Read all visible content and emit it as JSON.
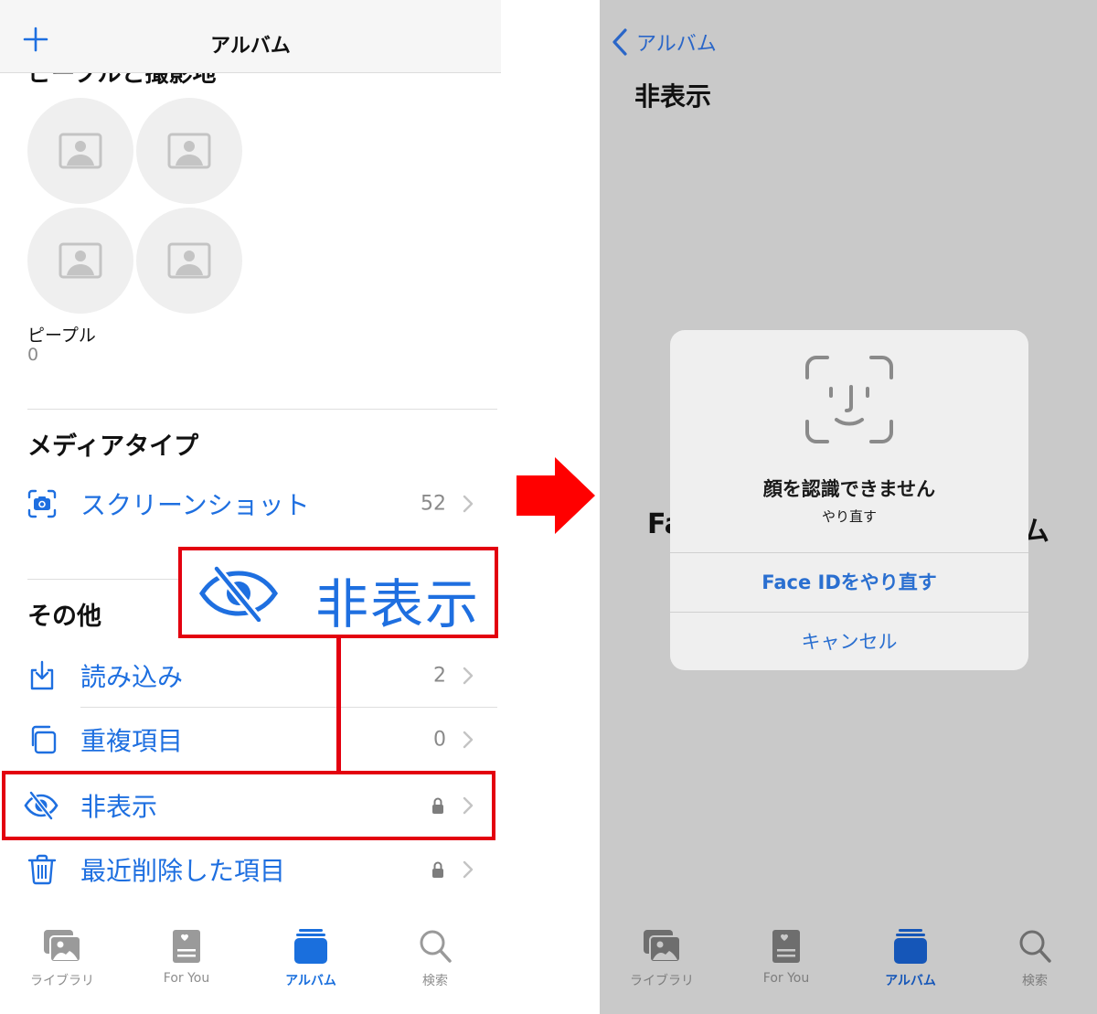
{
  "left": {
    "navbar": {
      "title": "アルバム",
      "add_icon": "plus-icon"
    },
    "cut_heading": "ピープルと撮影地",
    "people": {
      "label": "ピープル",
      "count": "0",
      "placeholder_icon": "person-placeholder-icon"
    },
    "media_types": {
      "title": "メディアタイプ",
      "items": [
        {
          "label": "スクリーンショット",
          "count": "52",
          "icon": "screenshot-icon"
        }
      ]
    },
    "other": {
      "title": "その他",
      "items": [
        {
          "label": "読み込み",
          "count": "2",
          "icon": "import-icon",
          "locked": false
        },
        {
          "label": "重複項目",
          "count": "0",
          "icon": "duplicate-icon",
          "locked": false
        },
        {
          "label": "非表示",
          "count": "",
          "icon": "eye-slash-icon",
          "locked": true
        },
        {
          "label": "最近削除した項目",
          "count": "",
          "icon": "trash-icon",
          "locked": true
        }
      ]
    },
    "callout": {
      "label": "非表示",
      "icon": "eye-slash-icon",
      "color": "#e3000f"
    },
    "tabbar": [
      {
        "label": "ライブラリ",
        "icon": "photo-library-icon",
        "active": false
      },
      {
        "label": "For You",
        "icon": "for-you-icon",
        "active": false
      },
      {
        "label": "アルバム",
        "icon": "albums-icon",
        "active": true
      },
      {
        "label": "検索",
        "icon": "search-icon",
        "active": false
      }
    ]
  },
  "arrow": {
    "icon": "right-arrow-icon",
    "color": "#ff0000"
  },
  "right": {
    "back_label": "アルバム",
    "title": "非表示",
    "background_text_left": "Fa",
    "background_text_right": "ム",
    "dialog": {
      "icon": "face-id-icon",
      "title": "顔を認識できません",
      "subtitle": "やり直す",
      "primary_button": "Face IDをやり直す",
      "cancel_button": "キャンセル"
    },
    "tabbar": [
      {
        "label": "ライブラリ",
        "icon": "photo-library-icon",
        "active": false
      },
      {
        "label": "For You",
        "icon": "for-you-icon",
        "active": false
      },
      {
        "label": "アルバム",
        "icon": "albums-icon",
        "active": true
      },
      {
        "label": "検索",
        "icon": "search-icon",
        "active": false
      }
    ]
  },
  "colors": {
    "accent": "#1e6fe0",
    "highlight": "#e3000f",
    "dim_background": "#c9c9c9"
  }
}
